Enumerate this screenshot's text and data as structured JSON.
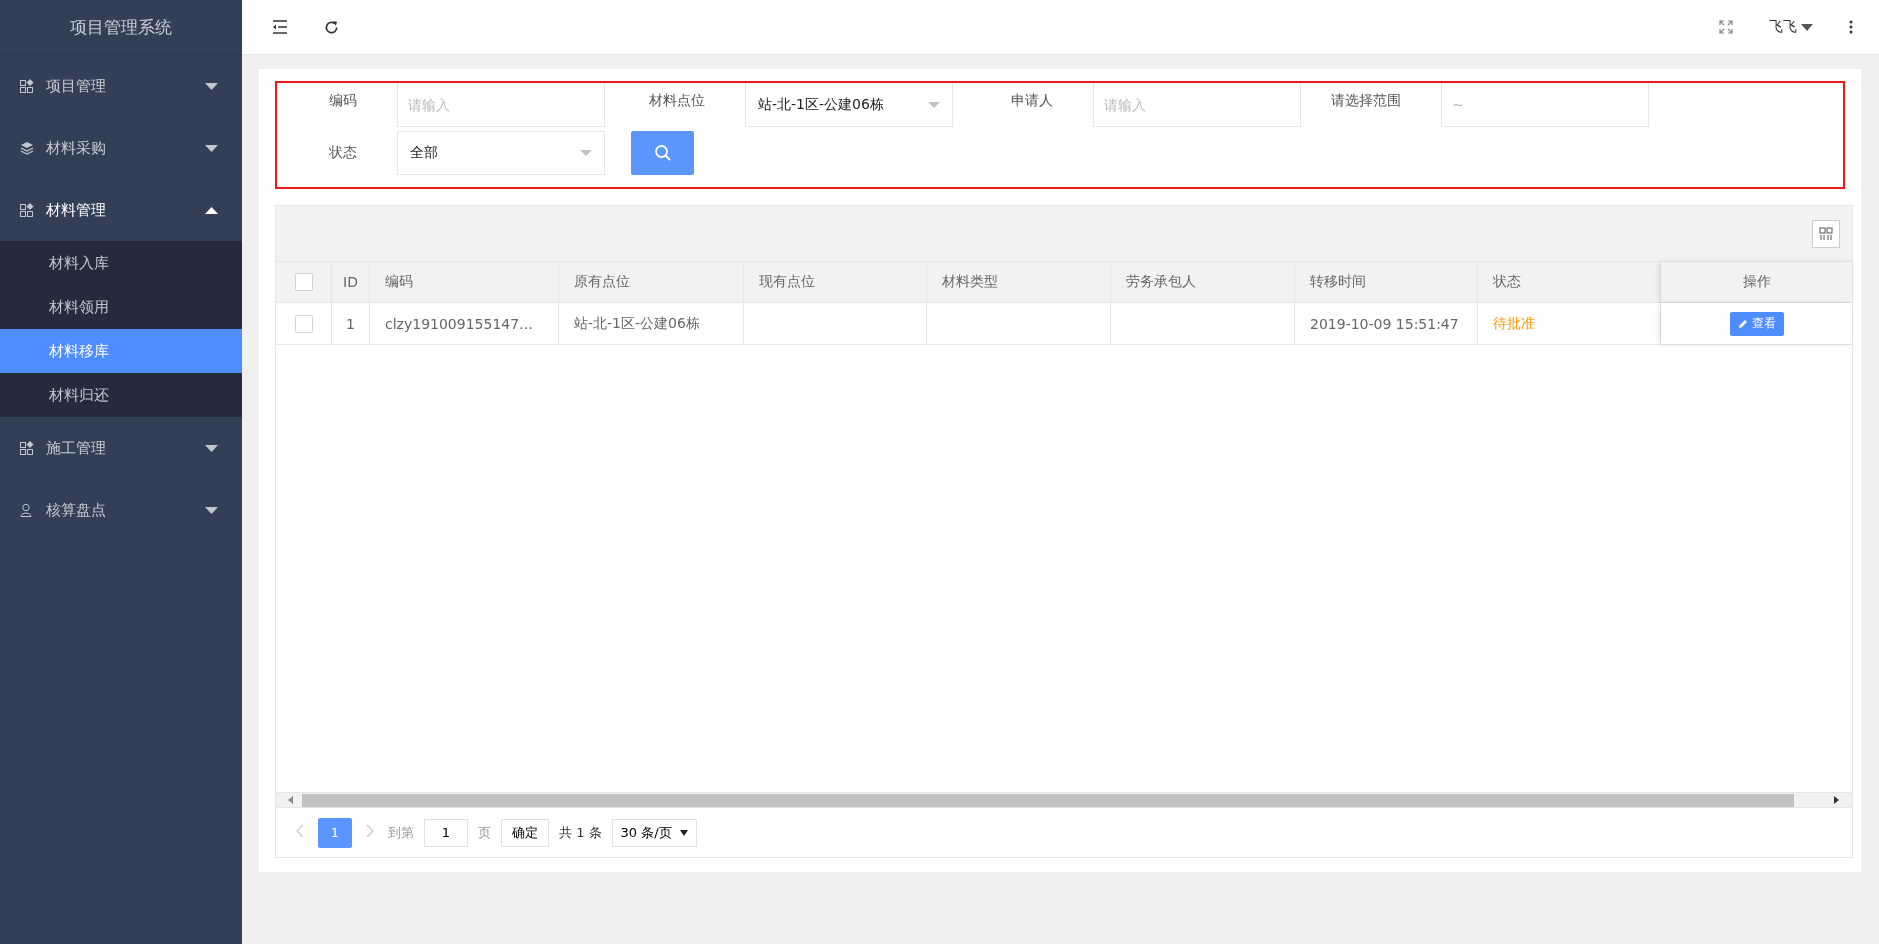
{
  "sidebar": {
    "title": "项目管理系统",
    "items": [
      {
        "label": "项目管理",
        "kind": "grid",
        "expanded": false
      },
      {
        "label": "材料采购",
        "kind": "layers",
        "expanded": false
      },
      {
        "label": "材料管理",
        "kind": "grid",
        "expanded": true,
        "children": [
          {
            "label": "材料入库",
            "selected": false
          },
          {
            "label": "材料领用",
            "selected": false
          },
          {
            "label": "材料移库",
            "selected": true
          },
          {
            "label": "材料归还",
            "selected": false
          }
        ]
      },
      {
        "label": "施工管理",
        "kind": "grid",
        "expanded": false
      },
      {
        "label": "核算盘点",
        "kind": "user",
        "expanded": false
      }
    ]
  },
  "header": {
    "user": "飞飞"
  },
  "filters": [
    {
      "label": "编码",
      "kind": "input",
      "placeholder": "请输入"
    },
    {
      "label": "材料点位",
      "kind": "select",
      "value": "站-北-1区-公建06栋"
    },
    {
      "label": "申请人",
      "kind": "input",
      "placeholder": "请输入"
    },
    {
      "label": "请选择范围",
      "kind": "input",
      "placeholder": "~"
    },
    {
      "label": "状态",
      "kind": "select",
      "value": "全部"
    }
  ],
  "table": {
    "columns": [
      "ID",
      "编码",
      "原有点位",
      "现有点位",
      "材料类型",
      "劳务承包人",
      "转移时间",
      "状态",
      "操作"
    ],
    "header_checked": false,
    "rows": [
      {
        "checked": false,
        "cells": [
          "1",
          "clzy191009155147…",
          "站-北-1区-公建06栋",
          "",
          "",
          "",
          "2019-10-09 15:51:47",
          "待批准"
        ],
        "action": "查看"
      }
    ]
  },
  "pagination": {
    "prev_disabled": true,
    "pages": [
      {
        "label": "1",
        "selected": true
      }
    ],
    "goto_label": "到第",
    "goto_value": "1",
    "page_unit": "页",
    "confirm": "确定",
    "total": "共 1 条",
    "page_size": "30 条/页"
  }
}
